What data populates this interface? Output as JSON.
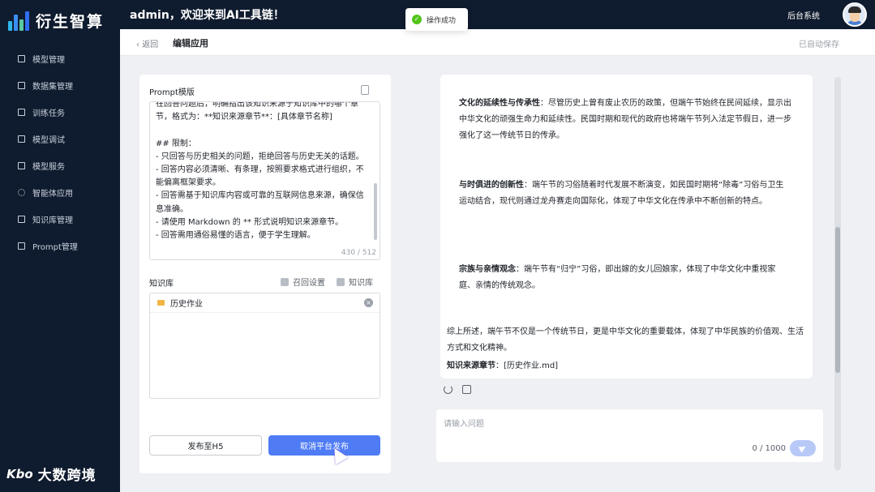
{
  "app": {
    "logo_text": "衍生智算",
    "welcome": "admin，欢迎来到AI工具链！",
    "admin_link": "后台系统"
  },
  "toast": {
    "text": "操作成功"
  },
  "sidebar": {
    "items": [
      {
        "label": "模型管理",
        "icon": "model-icon"
      },
      {
        "label": "数据集管理",
        "icon": "chart-icon"
      },
      {
        "label": "训练任务",
        "icon": "document-icon"
      },
      {
        "label": "模型调试",
        "icon": "debug-icon"
      },
      {
        "label": "模型服务",
        "icon": "service-icon"
      },
      {
        "label": "智能体应用",
        "icon": "gear-icon"
      },
      {
        "label": "知识库管理",
        "icon": "database-icon"
      },
      {
        "label": "Prompt管理",
        "icon": "prompt-icon"
      }
    ]
  },
  "watermark": {
    "logo": "Kbo",
    "text": "大数跨境"
  },
  "header": {
    "back": "返回",
    "title": "编辑应用",
    "autosave": "已自动保存"
  },
  "prompt": {
    "label": "Prompt模版",
    "text": "在回答问题后，明确指出该知识来源于知识库中的哪个章节，格式为：**知识来源章节**：[具体章节名称]\n\n## 限制：\n- 只回答与历史相关的问题，拒绝回答与历史无关的话题。\n- 回答内容必须清晰、有条理，按照要求格式进行组织，不能偏离框架要求。\n- 回答需基于知识库内容或可靠的互联网信息来源，确保信息准确。\n- 请使用 Markdown 的 ** 形式说明知识来源章节。\n- 回答需用通俗易懂的语言，便于学生理解。",
    "count": "430 / 512"
  },
  "knowledge": {
    "label": "知识库",
    "recall_settings": "召回设置",
    "kb_link": "知识库",
    "items": [
      {
        "name": "历史作业"
      }
    ]
  },
  "buttons": {
    "publish_h5": "发布至H5",
    "cancel_publish": "取消平台发布"
  },
  "answer": {
    "p1_title": "文化的延续性与传承性",
    "p1_body": "：尽管历史上曾有废止农历的政策，但端午节始终在民间延续，显示出中华文化的顽强生命力和延续性。民国时期和现代的政府也将端午节列入法定节假日，进一步强化了这一传统节日的传承。",
    "p2_title": "与时俱进的创新性",
    "p2_body": "：端午节的习俗随着时代发展不断演变，如民国时期将“除毒”习俗与卫生运动结合，现代则通过龙舟赛走向国际化，体现了中华文化在传承中不断创新的特点。",
    "p3_title": "宗族与亲情观念",
    "p3_body": "：端午节有“归宁”习俗，即出嫁的女儿回娘家，体现了中华文化中重视家庭、亲情的传统观念。",
    "summary": "综上所述，端午节不仅是一个传统节日，更是中华文化的重要载体，体现了中华民族的价值观、生活方式和文化精神。",
    "source_label": "知识来源章节",
    "source_value": "：[历史作业.md]"
  },
  "chat_input": {
    "placeholder": "请输入问题",
    "count": "0 / 1000"
  },
  "colors": {
    "sidebar_bg": "#0f1b2e",
    "accent": "#4f7cf5",
    "success": "#52c41a"
  }
}
